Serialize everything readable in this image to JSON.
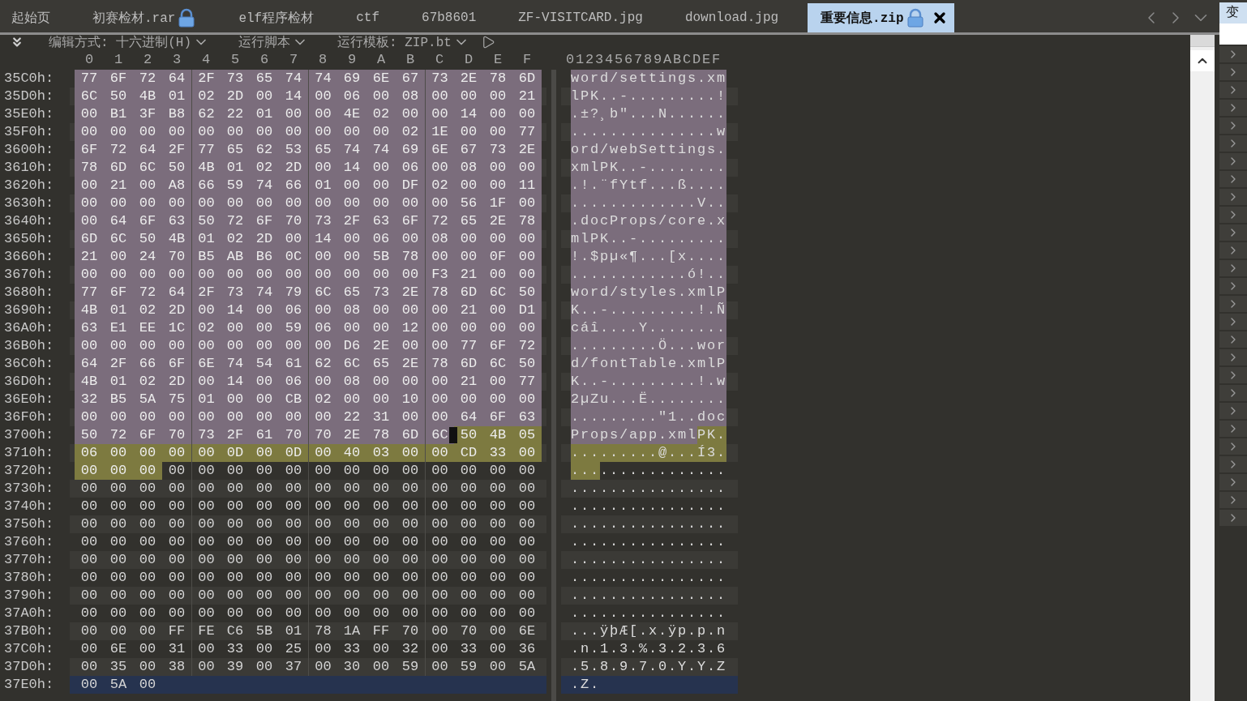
{
  "tabs": [
    {
      "label": "起始页",
      "selected": false,
      "locked": false,
      "closable": false
    },
    {
      "label": "初赛检材.rar",
      "selected": false,
      "locked": true,
      "closable": false
    },
    {
      "label": "elf程序检材",
      "selected": false,
      "locked": false,
      "closable": false
    },
    {
      "label": "ctf",
      "selected": false,
      "locked": false,
      "closable": false
    },
    {
      "label": "67b8601",
      "selected": false,
      "locked": false,
      "closable": false
    },
    {
      "label": "ZF-VISITCARD.jpg",
      "selected": false,
      "locked": false,
      "closable": false
    },
    {
      "label": "download.jpg",
      "selected": false,
      "locked": false,
      "closable": false
    },
    {
      "label": "重要信息.zip",
      "selected": true,
      "locked": true,
      "closable": true
    }
  ],
  "toolbar": [
    {
      "kind": "dropdown",
      "label": "编辑方式: 十六进制(H)"
    },
    {
      "kind": "dropdown",
      "label": "运行脚本"
    },
    {
      "kind": "dropdown",
      "label": "运行模板: ZIP.bt"
    },
    {
      "kind": "run"
    }
  ],
  "hex_columns": [
    "0",
    "1",
    "2",
    "3",
    "4",
    "5",
    "6",
    "7",
    "8",
    "9",
    "A",
    "B",
    "C",
    "D",
    "E",
    "F"
  ],
  "ascii_header": "0123456789ABCDEF",
  "rows": [
    {
      "address": "35C0h:",
      "selected": false,
      "groups": [
        {
          "color": "#7b6d7c",
          "bytes": [
            "77",
            "6F",
            "72",
            "64",
            "2F",
            "73",
            "65",
            "74",
            "74",
            "69",
            "6E",
            "67",
            "73",
            "2E",
            "78",
            "6D"
          ],
          "ascii": "word/settings.xm"
        }
      ]
    },
    {
      "address": "35D0h:",
      "selected": false,
      "groups": [
        {
          "color": "#7b6d7c",
          "bytes": [
            "6C",
            "50",
            "4B",
            "01",
            "02",
            "2D",
            "00",
            "14",
            "00",
            "06",
            "00",
            "08",
            "00",
            "00",
            "00",
            "21"
          ],
          "ascii": "lPK..-.........!"
        }
      ]
    },
    {
      "address": "35E0h:",
      "selected": false,
      "groups": [
        {
          "color": "#7b6d7c",
          "bytes": [
            "00",
            "B1",
            "3F",
            "B8",
            "62",
            "22",
            "01",
            "00",
            "00",
            "4E",
            "02",
            "00",
            "00",
            "14",
            "00",
            "00"
          ],
          "ascii": ".±?¸b\"...N......"
        }
      ]
    },
    {
      "address": "35F0h:",
      "selected": false,
      "groups": [
        {
          "color": "#7b6d7c",
          "bytes": [
            "00",
            "00",
            "00",
            "00",
            "00",
            "00",
            "00",
            "00",
            "00",
            "00",
            "00",
            "02",
            "1E",
            "00",
            "00",
            "77"
          ],
          "ascii": "...............w"
        }
      ]
    },
    {
      "address": "3600h:",
      "selected": false,
      "groups": [
        {
          "color": "#7b6d7c",
          "bytes": [
            "6F",
            "72",
            "64",
            "2F",
            "77",
            "65",
            "62",
            "53",
            "65",
            "74",
            "74",
            "69",
            "6E",
            "67",
            "73",
            "2E"
          ],
          "ascii": "ord/webSettings."
        }
      ]
    },
    {
      "address": "3610h:",
      "selected": false,
      "groups": [
        {
          "color": "#7b6d7c",
          "bytes": [
            "78",
            "6D",
            "6C",
            "50",
            "4B",
            "01",
            "02",
            "2D",
            "00",
            "14",
            "00",
            "06",
            "00",
            "08",
            "00",
            "00"
          ],
          "ascii": "xmlPK..-........"
        }
      ]
    },
    {
      "address": "3620h:",
      "selected": false,
      "groups": [
        {
          "color": "#7b6d7c",
          "bytes": [
            "00",
            "21",
            "00",
            "A8",
            "66",
            "59",
            "74",
            "66",
            "01",
            "00",
            "00",
            "DF",
            "02",
            "00",
            "00",
            "11"
          ],
          "ascii": ".!.¨fYtf...ß...."
        }
      ]
    },
    {
      "address": "3630h:",
      "selected": false,
      "groups": [
        {
          "color": "#7b6d7c",
          "bytes": [
            "00",
            "00",
            "00",
            "00",
            "00",
            "00",
            "00",
            "00",
            "00",
            "00",
            "00",
            "00",
            "00",
            "56",
            "1F",
            "00"
          ],
          "ascii": ".............V.."
        }
      ]
    },
    {
      "address": "3640h:",
      "selected": false,
      "groups": [
        {
          "color": "#7b6d7c",
          "bytes": [
            "00",
            "64",
            "6F",
            "63",
            "50",
            "72",
            "6F",
            "70",
            "73",
            "2F",
            "63",
            "6F",
            "72",
            "65",
            "2E",
            "78"
          ],
          "ascii": ".docProps/core.x"
        }
      ]
    },
    {
      "address": "3650h:",
      "selected": false,
      "groups": [
        {
          "color": "#7b6d7c",
          "bytes": [
            "6D",
            "6C",
            "50",
            "4B",
            "01",
            "02",
            "2D",
            "00",
            "14",
            "00",
            "06",
            "00",
            "08",
            "00",
            "00",
            "00"
          ],
          "ascii": "mlPK..-........."
        }
      ]
    },
    {
      "address": "3660h:",
      "selected": false,
      "groups": [
        {
          "color": "#7b6d7c",
          "bytes": [
            "21",
            "00",
            "24",
            "70",
            "B5",
            "AB",
            "B6",
            "0C",
            "00",
            "00",
            "5B",
            "78",
            "00",
            "00",
            "0F",
            "00"
          ],
          "ascii": "!.$pµ«¶...[x...."
        }
      ]
    },
    {
      "address": "3670h:",
      "selected": false,
      "groups": [
        {
          "color": "#7b6d7c",
          "bytes": [
            "00",
            "00",
            "00",
            "00",
            "00",
            "00",
            "00",
            "00",
            "00",
            "00",
            "00",
            "00",
            "F3",
            "21",
            "00",
            "00"
          ],
          "ascii": "............ó!.."
        }
      ]
    },
    {
      "address": "3680h:",
      "selected": false,
      "groups": [
        {
          "color": "#7b6d7c",
          "bytes": [
            "77",
            "6F",
            "72",
            "64",
            "2F",
            "73",
            "74",
            "79",
            "6C",
            "65",
            "73",
            "2E",
            "78",
            "6D",
            "6C",
            "50"
          ],
          "ascii": "word/styles.xmlP"
        }
      ]
    },
    {
      "address": "3690h:",
      "selected": false,
      "groups": [
        {
          "color": "#7b6d7c",
          "bytes": [
            "4B",
            "01",
            "02",
            "2D",
            "00",
            "14",
            "00",
            "06",
            "00",
            "08",
            "00",
            "00",
            "00",
            "21",
            "00",
            "D1"
          ],
          "ascii": "K..-.........!.Ñ"
        }
      ]
    },
    {
      "address": "36A0h:",
      "selected": false,
      "groups": [
        {
          "color": "#7b6d7c",
          "bytes": [
            "63",
            "E1",
            "EE",
            "1C",
            "02",
            "00",
            "00",
            "59",
            "06",
            "00",
            "00",
            "12",
            "00",
            "00",
            "00",
            "00"
          ],
          "ascii": "cáî....Y........"
        }
      ]
    },
    {
      "address": "36B0h:",
      "selected": false,
      "groups": [
        {
          "color": "#7b6d7c",
          "bytes": [
            "00",
            "00",
            "00",
            "00",
            "00",
            "00",
            "00",
            "00",
            "00",
            "D6",
            "2E",
            "00",
            "00",
            "77",
            "6F",
            "72"
          ],
          "ascii": ".........Ö...wor"
        }
      ]
    },
    {
      "address": "36C0h:",
      "selected": false,
      "groups": [
        {
          "color": "#7b6d7c",
          "bytes": [
            "64",
            "2F",
            "66",
            "6F",
            "6E",
            "74",
            "54",
            "61",
            "62",
            "6C",
            "65",
            "2E",
            "78",
            "6D",
            "6C",
            "50"
          ],
          "ascii": "d/fontTable.xmlP"
        }
      ]
    },
    {
      "address": "36D0h:",
      "selected": false,
      "groups": [
        {
          "color": "#7b6d7c",
          "bytes": [
            "4B",
            "01",
            "02",
            "2D",
            "00",
            "14",
            "00",
            "06",
            "00",
            "08",
            "00",
            "00",
            "00",
            "21",
            "00",
            "77"
          ],
          "ascii": "K..-.........!.w"
        }
      ]
    },
    {
      "address": "36E0h:",
      "selected": false,
      "groups": [
        {
          "color": "#7b6d7c",
          "bytes": [
            "32",
            "B5",
            "5A",
            "75",
            "01",
            "00",
            "00",
            "CB",
            "02",
            "00",
            "00",
            "10",
            "00",
            "00",
            "00",
            "00"
          ],
          "ascii": "2µZu...Ë........"
        }
      ]
    },
    {
      "address": "36F0h:",
      "selected": false,
      "groups": [
        {
          "color": "#7b6d7c",
          "bytes": [
            "00",
            "00",
            "00",
            "00",
            "00",
            "00",
            "00",
            "00",
            "00",
            "22",
            "31",
            "00",
            "00",
            "64",
            "6F",
            "63"
          ],
          "ascii": ".........\"1..doc"
        }
      ]
    },
    {
      "address": "3700h:",
      "selected": false,
      "groups": [
        {
          "color": "#7b6d7c",
          "bytes": [
            "50",
            "72",
            "6F",
            "70",
            "73",
            "2F",
            "61",
            "70",
            "70",
            "2E",
            "78",
            "6D",
            "6C"
          ],
          "ascii": "Props/app.xml"
        },
        {
          "color": "#7d7a40",
          "cursor": true,
          "bytes": [
            "50",
            "4B",
            "05"
          ],
          "ascii": "PK."
        }
      ]
    },
    {
      "address": "3710h:",
      "selected": false,
      "groups": [
        {
          "color": "#7d7a40",
          "bytes": [
            "06",
            "00",
            "00",
            "00",
            "00",
            "0D",
            "00",
            "0D",
            "00",
            "40",
            "03",
            "00",
            "00",
            "CD",
            "33",
            "00"
          ],
          "ascii": ".........@...Í3."
        }
      ]
    },
    {
      "address": "3720h:",
      "selected": false,
      "groups": [
        {
          "color": "#7d7a40",
          "bytes": [
            "00",
            "00",
            "00"
          ],
          "ascii": "..."
        },
        {
          "bytes": [
            "00",
            "00",
            "00",
            "00",
            "00",
            "00",
            "00",
            "00",
            "00",
            "00",
            "00",
            "00",
            "00"
          ],
          "ascii": "............."
        }
      ]
    },
    {
      "address": "3730h:",
      "selected": false,
      "groups": [
        {
          "bytes": [
            "00",
            "00",
            "00",
            "00",
            "00",
            "00",
            "00",
            "00",
            "00",
            "00",
            "00",
            "00",
            "00",
            "00",
            "00",
            "00"
          ],
          "ascii": "................"
        }
      ]
    },
    {
      "address": "3740h:",
      "selected": false,
      "groups": [
        {
          "bytes": [
            "00",
            "00",
            "00",
            "00",
            "00",
            "00",
            "00",
            "00",
            "00",
            "00",
            "00",
            "00",
            "00",
            "00",
            "00",
            "00"
          ],
          "ascii": "................"
        }
      ]
    },
    {
      "address": "3750h:",
      "selected": false,
      "groups": [
        {
          "bytes": [
            "00",
            "00",
            "00",
            "00",
            "00",
            "00",
            "00",
            "00",
            "00",
            "00",
            "00",
            "00",
            "00",
            "00",
            "00",
            "00"
          ],
          "ascii": "................"
        }
      ]
    },
    {
      "address": "3760h:",
      "selected": false,
      "groups": [
        {
          "bytes": [
            "00",
            "00",
            "00",
            "00",
            "00",
            "00",
            "00",
            "00",
            "00",
            "00",
            "00",
            "00",
            "00",
            "00",
            "00",
            "00"
          ],
          "ascii": "................"
        }
      ]
    },
    {
      "address": "3770h:",
      "selected": false,
      "groups": [
        {
          "bytes": [
            "00",
            "00",
            "00",
            "00",
            "00",
            "00",
            "00",
            "00",
            "00",
            "00",
            "00",
            "00",
            "00",
            "00",
            "00",
            "00"
          ],
          "ascii": "................"
        }
      ]
    },
    {
      "address": "3780h:",
      "selected": false,
      "groups": [
        {
          "bytes": [
            "00",
            "00",
            "00",
            "00",
            "00",
            "00",
            "00",
            "00",
            "00",
            "00",
            "00",
            "00",
            "00",
            "00",
            "00",
            "00"
          ],
          "ascii": "................"
        }
      ]
    },
    {
      "address": "3790h:",
      "selected": false,
      "groups": [
        {
          "bytes": [
            "00",
            "00",
            "00",
            "00",
            "00",
            "00",
            "00",
            "00",
            "00",
            "00",
            "00",
            "00",
            "00",
            "00",
            "00",
            "00"
          ],
          "ascii": "................"
        }
      ]
    },
    {
      "address": "37A0h:",
      "selected": false,
      "groups": [
        {
          "bytes": [
            "00",
            "00",
            "00",
            "00",
            "00",
            "00",
            "00",
            "00",
            "00",
            "00",
            "00",
            "00",
            "00",
            "00",
            "00",
            "00"
          ],
          "ascii": "................"
        }
      ]
    },
    {
      "address": "37B0h:",
      "selected": false,
      "groups": [
        {
          "bytes": [
            "00",
            "00",
            "00",
            "FF",
            "FE",
            "C6",
            "5B",
            "01",
            "78",
            "1A",
            "FF",
            "70",
            "00",
            "70",
            "00",
            "6E"
          ],
          "ascii": "...ÿþÆ[.x.ÿp.p.n"
        }
      ]
    },
    {
      "address": "37C0h:",
      "selected": false,
      "groups": [
        {
          "bytes": [
            "00",
            "6E",
            "00",
            "31",
            "00",
            "33",
            "00",
            "25",
            "00",
            "33",
            "00",
            "32",
            "00",
            "33",
            "00",
            "36"
          ],
          "ascii": ".n.1.3.%.3.2.3.6"
        }
      ]
    },
    {
      "address": "37D0h:",
      "selected": false,
      "groups": [
        {
          "bytes": [
            "00",
            "35",
            "00",
            "38",
            "00",
            "39",
            "00",
            "37",
            "00",
            "30",
            "00",
            "59",
            "00",
            "59",
            "00",
            "5A"
          ],
          "ascii": ".5.8.9.7.0.Y.Y.Z"
        }
      ]
    },
    {
      "address": "37E0h:",
      "selected": true,
      "groups": [
        {
          "bytes": [
            "00",
            "5A",
            "00"
          ],
          "ascii": ".Z."
        }
      ]
    }
  ],
  "side_panel": {
    "tab": "变"
  }
}
